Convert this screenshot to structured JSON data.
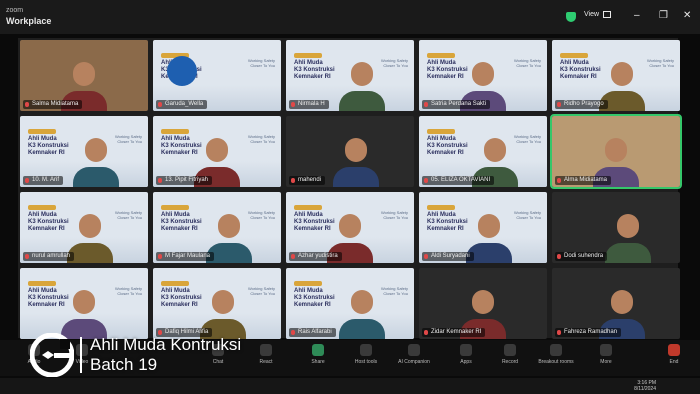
{
  "app": {
    "brand_top": "zoom",
    "brand_bottom": "Workplace",
    "view_label": "View"
  },
  "caption": {
    "line1": "Ahli Muda Kontruksi",
    "line2": "Batch 19"
  },
  "slide": {
    "title": "Ahli Muda\nK3 Konstruksi\nKemnaker RI",
    "tagline": "Working Safety\nCloser To You"
  },
  "participants": [
    {
      "name": "Salma Midiatama",
      "kind": "cam"
    },
    {
      "name": "Garuda_Wella",
      "kind": "logo"
    },
    {
      "name": "Nirmala H",
      "kind": "slide"
    },
    {
      "name": "Satria Perdana Sakti",
      "kind": "slide"
    },
    {
      "name": "Ridho Prayogo",
      "kind": "slide"
    },
    {
      "name": "10. M. Arif",
      "kind": "slide"
    },
    {
      "name": "13. Pipit Fitriyah",
      "kind": "slide"
    },
    {
      "name": "mahendi",
      "kind": "dark"
    },
    {
      "name": "05. ELIZA OKTAVIANI",
      "kind": "slide"
    },
    {
      "name": "Alma Midiatama",
      "kind": "cam"
    },
    {
      "name": "nurul amrullah",
      "kind": "slide"
    },
    {
      "name": "M Fajar Maulana",
      "kind": "slide"
    },
    {
      "name": "Azhar yudistira",
      "kind": "slide"
    },
    {
      "name": "Aldi Suryadani",
      "kind": "slide"
    },
    {
      "name": "Dodi suhendra",
      "kind": "dark"
    },
    {
      "name": "",
      "kind": "slide"
    },
    {
      "name": "Dafiq Hilmi Alifia",
      "kind": "slide"
    },
    {
      "name": "Rais Alfarabi",
      "kind": "slide"
    },
    {
      "name": "Zidar Kemnaker RI",
      "kind": "dark"
    },
    {
      "name": "Fahreza Ramadhan",
      "kind": "dark"
    }
  ],
  "toolbar": [
    {
      "label": "Audio"
    },
    {
      "label": "Video"
    },
    {
      "label": "Chat"
    },
    {
      "label": "React"
    },
    {
      "label": "Share"
    },
    {
      "label": "Host tools"
    },
    {
      "label": "AI Companion"
    },
    {
      "label": "Apps"
    },
    {
      "label": "Record"
    },
    {
      "label": "Breakout rooms"
    },
    {
      "label": "More"
    },
    {
      "label": "End"
    }
  ],
  "clock": {
    "time": "3:16 PM",
    "date": "8/11/2024"
  }
}
